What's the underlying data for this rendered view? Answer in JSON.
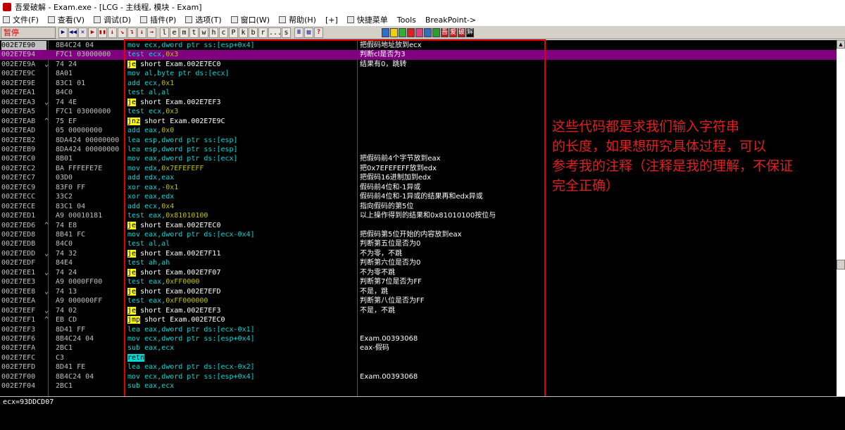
{
  "window": {
    "title": "吾爱破解 - Exam.exe - [LCG - 主线程, 模块 - Exam]"
  },
  "menu": [
    {
      "label": "文件(F)",
      "icon": "file-menu-icon"
    },
    {
      "label": "查看(V)",
      "icon": "view-menu-icon"
    },
    {
      "label": "调试(D)",
      "icon": "debug-menu-icon"
    },
    {
      "label": "插件(P)",
      "icon": "plugin-menu-icon"
    },
    {
      "label": "选项(T)",
      "icon": "options-menu-icon"
    },
    {
      "label": "窗口(W)",
      "icon": "window-menu-icon"
    },
    {
      "label": "帮助(H)",
      "icon": "help-menu-icon"
    },
    {
      "label": "[+]",
      "icon": ""
    },
    {
      "label": "快捷菜单",
      "icon": "shortcut-menu-icon"
    },
    {
      "label": "Tools",
      "icon": ""
    },
    {
      "label": "BreakPoint->",
      "icon": ""
    }
  ],
  "toolbar": {
    "status": "暂停",
    "nav_buttons": [
      "▶",
      "◀◀",
      "✕",
      "▶",
      "▮▮",
      "↓",
      "↘",
      "↴",
      "↓",
      "→"
    ],
    "letter_buttons": [
      "l",
      "e",
      "m",
      "t",
      "w",
      "h",
      "c",
      "P",
      "k",
      "b",
      "r",
      "...",
      "s"
    ],
    "tool_buttons": [
      "≡",
      "▤",
      "?"
    ],
    "plugin_colors": [
      "#2a6fd6",
      "#f0d000",
      "#30b030",
      "#e02020",
      "#e04080",
      "#3070c0",
      "#2d9d2d",
      "#c02020",
      "#d02020",
      "#c02020",
      "#000000"
    ],
    "plugin_labels": [
      "",
      "",
      "",
      "",
      "",
      "",
      "",
      "吾",
      "爱",
      "破",
      "解"
    ]
  },
  "status_color": "#e00000",
  "rows": [
    {
      "addr": "002E7E90",
      "jmp": "",
      "hex": "8B4C24 04",
      "mn": "mov",
      "ops": [
        [
          "ecx,",
          "op"
        ],
        [
          "dword ptr ss:[esp+0x4]",
          "mem"
        ]
      ],
      "cmt": "把假码地址放到ecx",
      "cur": true
    },
    {
      "addr": "002E7E94",
      "jmp": "",
      "hex": "F7C1 03000000",
      "mn": "test",
      "ops": [
        [
          "ecx,",
          "op"
        ],
        [
          "0x3",
          "imm"
        ]
      ],
      "cmt": "判断cl是否为3",
      "sel": true
    },
    {
      "addr": "002E7E9A",
      "jmp": "⌄",
      "hex": "74 24",
      "mn": "je",
      "mnType": "jcc",
      "ops": [
        [
          "short Exam.002E7EC0",
          "target"
        ]
      ],
      "cmt": "结果有0，跳转"
    },
    {
      "addr": "002E7E9C",
      "jmp": "",
      "hex": "8A01",
      "mn": "mov",
      "ops": [
        [
          "al,",
          "op"
        ],
        [
          "byte ptr ds:[ecx]",
          "mem"
        ]
      ],
      "cmt": ""
    },
    {
      "addr": "002E7E9E",
      "jmp": "",
      "hex": "83C1 01",
      "mn": "add",
      "ops": [
        [
          "ecx,",
          "op"
        ],
        [
          "0x1",
          "imm"
        ]
      ],
      "cmt": ""
    },
    {
      "addr": "002E7EA1",
      "jmp": "",
      "hex": "84C0",
      "mn": "test",
      "ops": [
        [
          "al,al",
          "op"
        ]
      ],
      "cmt": ""
    },
    {
      "addr": "002E7EA3",
      "jmp": "⌄",
      "hex": "74 4E",
      "mn": "je",
      "mnType": "jcc",
      "ops": [
        [
          "short Exam.002E7EF3",
          "target"
        ]
      ],
      "cmt": ""
    },
    {
      "addr": "002E7EA5",
      "jmp": "",
      "hex": "F7C1 03000000",
      "mn": "test",
      "ops": [
        [
          "ecx,",
          "op"
        ],
        [
          "0x3",
          "imm"
        ]
      ],
      "cmt": ""
    },
    {
      "addr": "002E7EAB",
      "jmp": "^",
      "hex": "75 EF",
      "mn": "jnz",
      "mnType": "jcc",
      "ops": [
        [
          "short Exam.002E7E9C",
          "target"
        ]
      ],
      "cmt": ""
    },
    {
      "addr": "002E7EAD",
      "jmp": "",
      "hex": "05 00000000",
      "mn": "add",
      "ops": [
        [
          "eax,",
          "op"
        ],
        [
          "0x0",
          "imm"
        ]
      ],
      "cmt": ""
    },
    {
      "addr": "002E7EB2",
      "jmp": "",
      "hex": "8DA424 00000000",
      "mn": "lea",
      "ops": [
        [
          "esp,",
          "op"
        ],
        [
          "dword ptr ss:[esp]",
          "mem"
        ]
      ],
      "cmt": ""
    },
    {
      "addr": "002E7EB9",
      "jmp": "",
      "hex": "8DA424 00000000",
      "mn": "lea",
      "ops": [
        [
          "esp,",
          "op"
        ],
        [
          "dword ptr ss:[esp]",
          "mem"
        ]
      ],
      "cmt": ""
    },
    {
      "addr": "002E7EC0",
      "jmp": "",
      "hex": "8B01",
      "mn": "mov",
      "ops": [
        [
          "eax,",
          "op"
        ],
        [
          "dword ptr ds:[ecx]",
          "mem"
        ]
      ],
      "cmt": "把假码前4个字节放到eax"
    },
    {
      "addr": "002E7EC2",
      "jmp": "",
      "hex": "BA FFFEFE7E",
      "mn": "mov",
      "ops": [
        [
          "edx,",
          "op"
        ],
        [
          "0x7EFEFEFF",
          "imm"
        ]
      ],
      "cmt": "把0x7EFEFEFF放到edx"
    },
    {
      "addr": "002E7EC7",
      "jmp": "",
      "hex": "03D0",
      "mn": "add",
      "ops": [
        [
          "edx,eax",
          "op"
        ]
      ],
      "cmt": "把假码16进制加到edx"
    },
    {
      "addr": "002E7EC9",
      "jmp": "",
      "hex": "83F0 FF",
      "mn": "xor",
      "ops": [
        [
          "eax,",
          "op"
        ],
        [
          "-0x1",
          "imm"
        ]
      ],
      "cmt": "假码前4位和-1异或"
    },
    {
      "addr": "002E7ECC",
      "jmp": "",
      "hex": "33C2",
      "mn": "xor",
      "ops": [
        [
          "eax,edx",
          "op"
        ]
      ],
      "cmt": "假码前4位和-1异或的结果再和edx异或"
    },
    {
      "addr": "002E7ECE",
      "jmp": "",
      "hex": "83C1 04",
      "mn": "add",
      "ops": [
        [
          "ecx,",
          "op"
        ],
        [
          "0x4",
          "imm"
        ]
      ],
      "cmt": "指向假码的第5位"
    },
    {
      "addr": "002E7ED1",
      "jmp": "",
      "hex": "A9 00010181",
      "mn": "test",
      "ops": [
        [
          "eax,",
          "op"
        ],
        [
          "0x81010100",
          "imm"
        ]
      ],
      "cmt": "以上操作得到的结果和0x81010100按位与"
    },
    {
      "addr": "002E7ED6",
      "jmp": "^",
      "hex": "74 E8",
      "mn": "je",
      "mnType": "jcc",
      "ops": [
        [
          "short Exam.002E7EC0",
          "target"
        ]
      ],
      "cmt": ""
    },
    {
      "addr": "002E7ED8",
      "jmp": "",
      "hex": "8B41 FC",
      "mn": "mov",
      "ops": [
        [
          "eax,",
          "op"
        ],
        [
          "dword ptr ds:[ecx-0x4]",
          "mem"
        ]
      ],
      "cmt": "把假码第5位开始的内容放到eax"
    },
    {
      "addr": "002E7EDB",
      "jmp": "",
      "hex": "84C0",
      "mn": "test",
      "ops": [
        [
          "al,al",
          "op"
        ]
      ],
      "cmt": "判断第五位是否为0"
    },
    {
      "addr": "002E7EDD",
      "jmp": "⌄",
      "hex": "74 32",
      "mn": "je",
      "mnType": "jcc",
      "ops": [
        [
          "short Exam.002E7F11",
          "target"
        ]
      ],
      "cmt": "不为零，不跳"
    },
    {
      "addr": "002E7EDF",
      "jmp": "",
      "hex": "84E4",
      "mn": "test",
      "ops": [
        [
          "ah,ah",
          "op"
        ]
      ],
      "cmt": "判断第六位是否为0"
    },
    {
      "addr": "002E7EE1",
      "jmp": "⌄",
      "hex": "74 24",
      "mn": "je",
      "mnType": "jcc",
      "ops": [
        [
          "short Exam.002E7F07",
          "target"
        ]
      ],
      "cmt": "不为零不跳"
    },
    {
      "addr": "002E7EE3",
      "jmp": "",
      "hex": "A9 0000FF00",
      "mn": "test",
      "ops": [
        [
          "eax,",
          "op"
        ],
        [
          "0xFF0000",
          "imm"
        ]
      ],
      "cmt": "判断第7位是否为FF"
    },
    {
      "addr": "002E7EE8",
      "jmp": "⌄",
      "hex": "74 13",
      "mn": "je",
      "mnType": "jcc",
      "ops": [
        [
          "short Exam.002E7EFD",
          "target"
        ]
      ],
      "cmt": "不是，跳"
    },
    {
      "addr": "002E7EEA",
      "jmp": "",
      "hex": "A9 000000FF",
      "mn": "test",
      "ops": [
        [
          "eax,",
          "op"
        ],
        [
          "0xFF000000",
          "imm"
        ]
      ],
      "cmt": "判断第八位是否为FF"
    },
    {
      "addr": "002E7EEF",
      "jmp": "⌄",
      "hex": "74 02",
      "mn": "je",
      "mnType": "jcc",
      "ops": [
        [
          "short Exam.002E7EF3",
          "target"
        ]
      ],
      "cmt": "不是，不跳"
    },
    {
      "addr": "002E7EF1",
      "jmp": "^",
      "hex": "EB CD",
      "mn": "jmp",
      "mnType": "jcc",
      "ops": [
        [
          "short Exam.002E7EC0",
          "target"
        ]
      ],
      "cmt": ""
    },
    {
      "addr": "002E7EF3",
      "jmp": "",
      "hex": "8D41 FF",
      "mn": "lea",
      "ops": [
        [
          "eax,",
          "op"
        ],
        [
          "dword ptr ds:[ecx-0x1]",
          "mem"
        ]
      ],
      "cmt": ""
    },
    {
      "addr": "002E7EF6",
      "jmp": "",
      "hex": "8B4C24 04",
      "mn": "mov",
      "ops": [
        [
          "ecx,",
          "op"
        ],
        [
          "dword ptr ss:[esp+0x4]",
          "mem"
        ]
      ],
      "cmt": "Exam.00393068"
    },
    {
      "addr": "002E7EFA",
      "jmp": "",
      "hex": "2BC1",
      "mn": "sub",
      "ops": [
        [
          "eax,ecx",
          "op"
        ]
      ],
      "cmt": "eax-假码"
    },
    {
      "addr": "002E7EFC",
      "jmp": "",
      "hex": "C3",
      "mn": "retn",
      "mnType": "ret",
      "ops": [],
      "cmt": ""
    },
    {
      "addr": "002E7EFD",
      "jmp": "",
      "hex": "8D41 FE",
      "mn": "lea",
      "ops": [
        [
          "eax,",
          "op"
        ],
        [
          "dword ptr ds:[ecx-0x2]",
          "mem"
        ]
      ],
      "cmt": ""
    },
    {
      "addr": "002E7F00",
      "jmp": "",
      "hex": "8B4C24 04",
      "mn": "mov",
      "ops": [
        [
          "ecx,",
          "op"
        ],
        [
          "dword ptr ss:[esp+0x4]",
          "mem"
        ]
      ],
      "cmt": "Exam.00393068"
    },
    {
      "addr": "002E7F04",
      "jmp": "",
      "hex": "2BC1",
      "mn": "sub",
      "ops": [
        [
          "eax,ecx",
          "op"
        ]
      ],
      "cmt": ""
    }
  ],
  "annotation": {
    "lines": [
      "这些代码都是求我们输入字符串",
      "的长度，如果想研究具体过程，可以",
      "参考我的注释（注释是我的理解，不保证",
      "完全正确）"
    ],
    "color": "#e02020"
  },
  "info_pane": {
    "text": "ecx=93DDCD07"
  }
}
